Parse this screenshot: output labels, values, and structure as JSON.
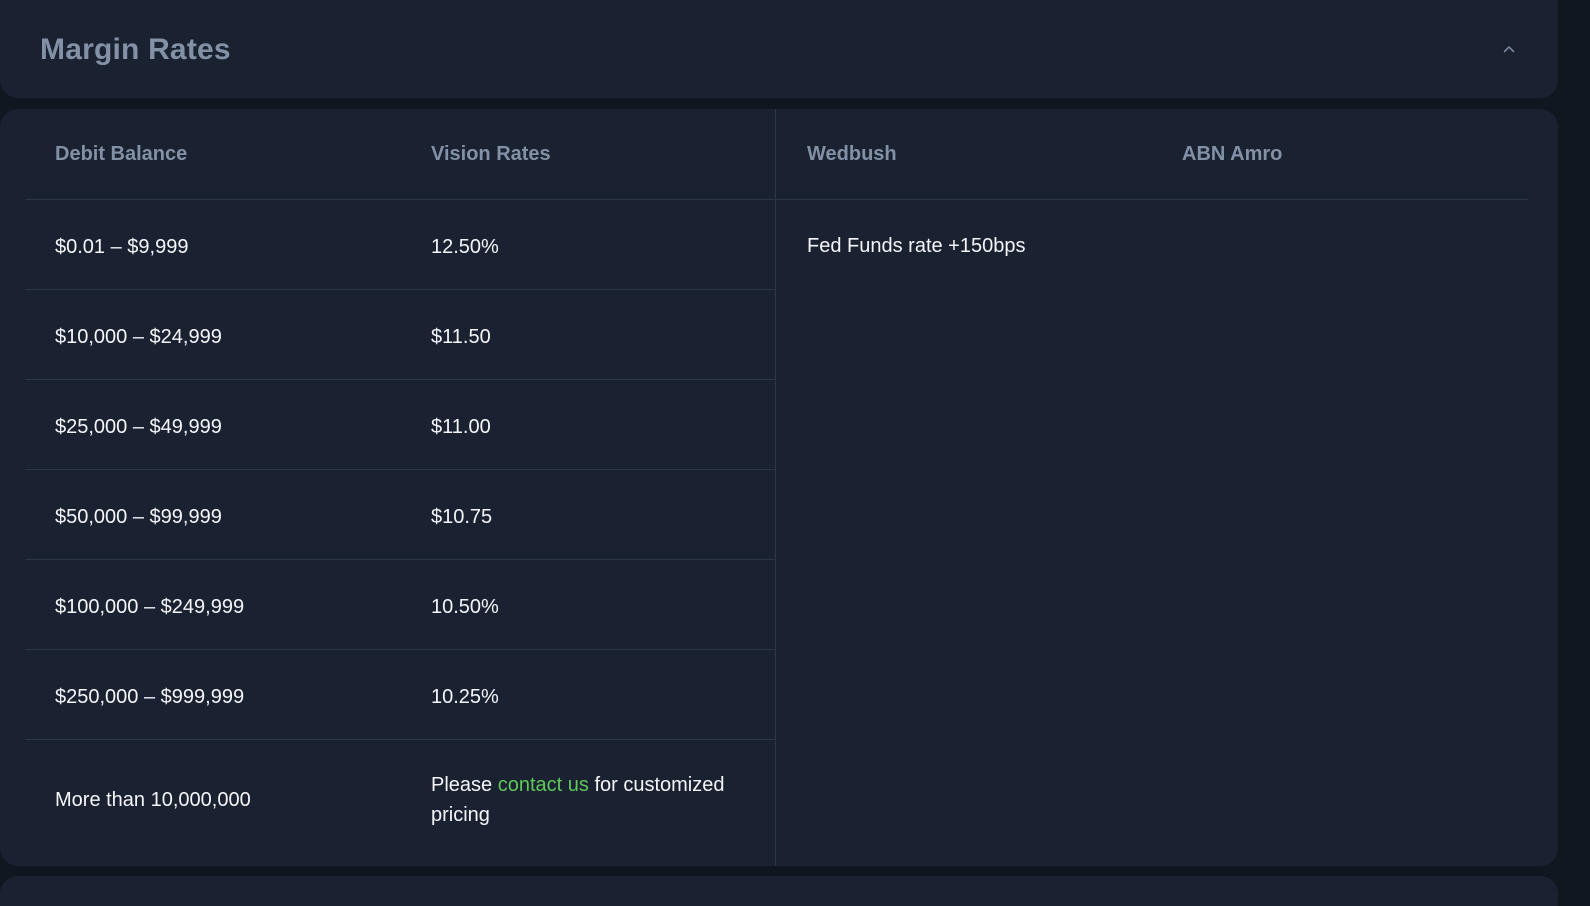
{
  "section": {
    "title": "Margin Rates"
  },
  "table": {
    "columns": {
      "debit_balance": "Debit Balance",
      "vision_rates": "Vision Rates",
      "wedbush": "Wedbush",
      "abn_amro": "ABN Amro"
    },
    "rows": [
      {
        "debit": "$0.01 – $9,999",
        "rate": "12.50%"
      },
      {
        "debit": "$10,000 – $24,999",
        "rate": "$11.50"
      },
      {
        "debit": "$25,000 – $49,999",
        "rate": "$11.00"
      },
      {
        "debit": "$50,000 – $99,999",
        "rate": "$10.75"
      },
      {
        "debit": "$100,000 – $249,999",
        "rate": "10.50%"
      },
      {
        "debit": "$250,000 – $999,999",
        "rate": "10.25%"
      },
      {
        "debit": "More than 10,000,000",
        "rate_prefix": "Please ",
        "rate_link": "contact us",
        "rate_suffix": " for customized pricing"
      }
    ],
    "wedbush_value": "Fed Funds rate +150bps"
  },
  "icons": {
    "collapse": "chevron-up-icon"
  },
  "colors": {
    "background": "#111720",
    "card": "#1a2130",
    "header_text": "#8391a7",
    "body_text": "#f4f6fa",
    "link": "#5fc85a",
    "divider": "#2d3646"
  }
}
